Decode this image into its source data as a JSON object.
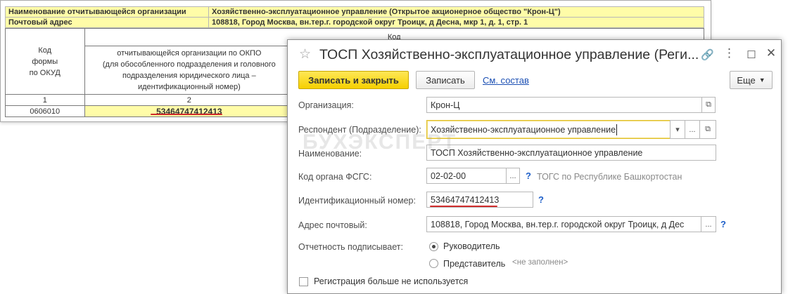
{
  "report": {
    "org_label": "Наименование отчитывающейся организации",
    "org_value": "Хозяйственно-эксплуатационное управление (Открытое акционерное общество \"Крон-Ц\")",
    "addr_label": "Почтовый адрес",
    "addr_value": "108818, Город Москва, вн.тер.г. городской округ Троицк, д Десна, мкр 1, д. 1, стр. 1",
    "kod_header": "Код",
    "okud_header": "Код\nформы\nпо ОКУД",
    "okpo_header": "отчитывающейся организации по ОКПО\n(для обособленного подразделения и головного\nподразделения юридического лица –\nидентификационный номер)",
    "col1": "1",
    "col2": "2",
    "okud_value": "0606010",
    "id_value": "53464747412413"
  },
  "dialog": {
    "title": "ТОСП Хозяйственно-эксплуатационное управление (Реги...",
    "star_icon": "star-icon",
    "btn_save_close": "Записать и закрыть",
    "btn_save": "Записать",
    "link_composition": "См. состав",
    "btn_more": "Еще",
    "org_label": "Организация:",
    "org_value": "Крон-Ц",
    "resp_label": "Респондент (Подразделение):",
    "resp_value": "Хозяйственно-эксплуатационное управление",
    "name_label": "Наименование:",
    "name_value": "ТОСП Хозяйственно-эксплуатационное управление",
    "fsgs_label": "Код органа ФСГС:",
    "fsgs_value": "02-02-00",
    "fsgs_hint": "ТОГС по Республике Башкортостан",
    "id_label": "Идентификационный номер:",
    "id_value": "53464747412413",
    "addr_label": "Адрес почтовый:",
    "addr_value": "108818, Город Москва, вн.тер.г. городской округ Троицк, д Дес",
    "signs_label": "Отчетность подписывает:",
    "signs_opt1": "Руководитель",
    "signs_opt2": "Представитель",
    "signs_opt2_hint": "<не заполнен>",
    "not_used_label": "Регистрация больше не используется",
    "q_mark": "?",
    "ellipsis": "...",
    "watermark": "БУХЭКСПЕРТ"
  },
  "colors": {
    "highlight": "#fffca8",
    "primary_button": "#f6d000",
    "link": "#1b4fb3",
    "underline_red": "#d12c2c"
  }
}
